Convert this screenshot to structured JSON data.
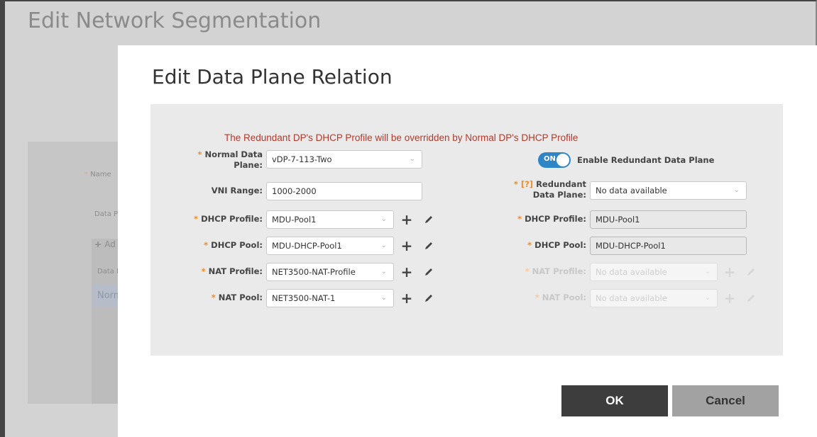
{
  "background": {
    "title": "Edit Network Segmentation",
    "fragments": [
      "Name",
      "Data P",
      "Ad",
      "Data F",
      "Norm"
    ]
  },
  "modal": {
    "title": "Edit Data Plane Relation",
    "warning": "The Redundant DP's DHCP Profile will be overridden by Normal DP's DHCP Profile",
    "required_mark": "*",
    "help_mark": "[?]",
    "left": {
      "normal_dp_label_1": "Normal Data",
      "normal_dp_label_2": "Plane:",
      "normal_dp_value": "vDP-7-113-Two",
      "vni_label": "VNI Range:",
      "vni_value": "1000-2000",
      "dhcp_profile_label": "DHCP Profile:",
      "dhcp_profile_value": "MDU-Pool1",
      "dhcp_pool_label": "DHCP Pool:",
      "dhcp_pool_value": "MDU-DHCP-Pool1",
      "nat_profile_label": "NAT Profile:",
      "nat_profile_value": "NET3500-NAT-Profile",
      "nat_pool_label": "NAT Pool:",
      "nat_pool_value": "NET3500-NAT-1"
    },
    "right": {
      "toggle_state": "ON",
      "toggle_label": "Enable Redundant Data Plane",
      "redundant_label_1": "Redundant",
      "redundant_label_2": "Data Plane:",
      "redundant_value": "No data available",
      "dhcp_profile_label": "DHCP Profile:",
      "dhcp_profile_value": "MDU-Pool1",
      "dhcp_pool_label": "DHCP Pool:",
      "dhcp_pool_value": "MDU-DHCP-Pool1",
      "nat_profile_label": "NAT Profile:",
      "nat_profile_value": "No data available",
      "nat_pool_label": "NAT Pool:",
      "nat_pool_value": "No data available"
    },
    "ok_label": "OK",
    "cancel_label": "Cancel"
  },
  "colors": {
    "accent": "#2f86c6",
    "required": "#f28c28",
    "warning": "#b13a2b"
  }
}
